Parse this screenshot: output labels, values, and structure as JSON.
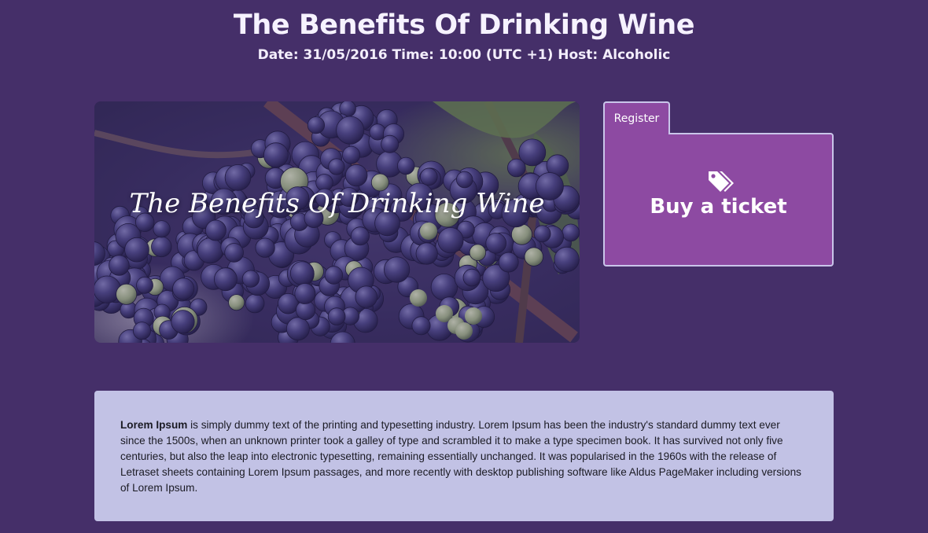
{
  "event": {
    "title": "The Benefits Of Drinking Wine",
    "meta": "Date: 31/05/2016 Time: 10:00 (UTC +1) Host: Alcoholic"
  },
  "hero": {
    "caption": "The Benefits Of Drinking Wine"
  },
  "register": {
    "tab_label": "Register",
    "buy_label": "Buy a ticket",
    "icon": "tags-icon"
  },
  "description": {
    "lead": "Lorem Ipsum",
    "body": " is simply dummy text of the printing and typesetting industry. Lorem Ipsum has been the industry's standard dummy text ever since the 1500s, when an unknown printer took a galley of type and scrambled it to make a type specimen book. It has survived not only five centuries, but also the leap into electronic typesetting, remaining essentially unchanged. It was popularised in the 1960s with the release of Letraset sheets containing Lorem Ipsum passages, and more recently with desktop publishing software like Aldus PageMaker including versions of Lorem Ipsum."
  },
  "colors": {
    "background": "#452f69",
    "panel": "#8d4aa2",
    "panel_border": "#c9c5ea",
    "description_bg": "#c2c2e5"
  }
}
